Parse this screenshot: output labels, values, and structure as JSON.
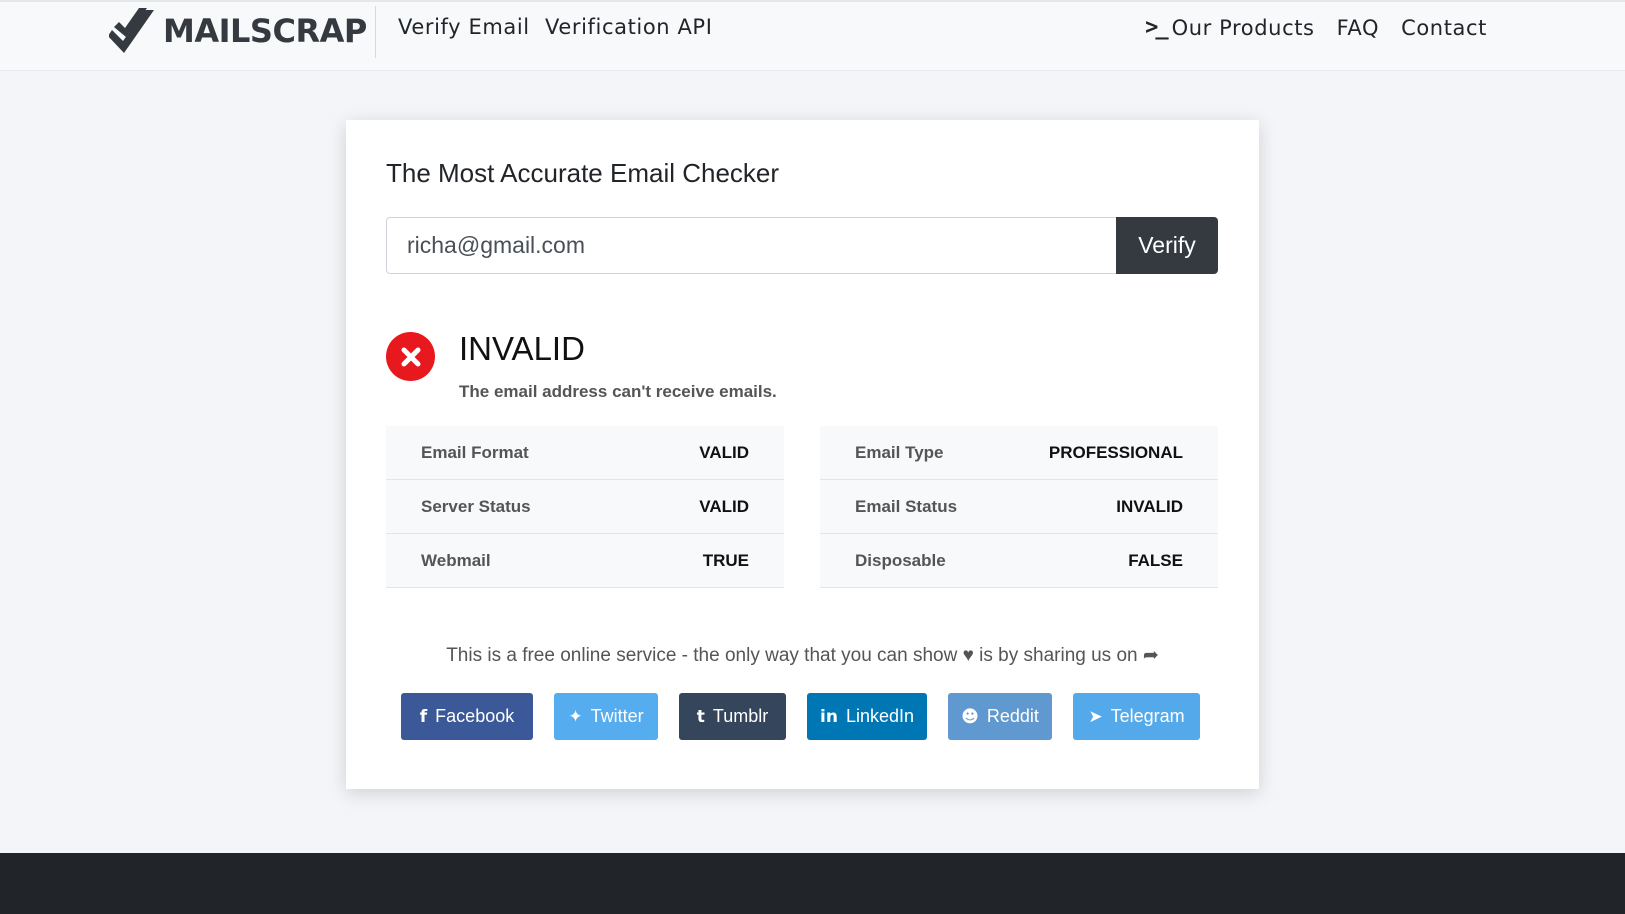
{
  "brand": {
    "name": "MAILSCRAP",
    "icon": "check-logo-icon"
  },
  "nav": {
    "left": [
      "Verify Email",
      "Verification API"
    ],
    "products": {
      "label": "Our Products",
      "icon": "terminal-icon"
    },
    "faq": "FAQ",
    "contact": "Contact"
  },
  "checker": {
    "title": "The Most Accurate Email Checker",
    "email_value": "richa@gmail.com",
    "verify_label": "Verify"
  },
  "result": {
    "status": "INVALID",
    "message": "The email address can't receive emails.",
    "status_color": "#e8181f",
    "left": [
      {
        "key": "Email Format",
        "value": "VALID"
      },
      {
        "key": "Server Status",
        "value": "VALID"
      },
      {
        "key": "Webmail",
        "value": "TRUE"
      }
    ],
    "right": [
      {
        "key": "Email Type",
        "value": "PROFESSIONAL"
      },
      {
        "key": "Email Status",
        "value": "INVALID"
      },
      {
        "key": "Disposable",
        "value": "FALSE"
      }
    ]
  },
  "share": {
    "text_before": "This is a free online service - the only way that you can show",
    "text_after": "is by sharing us on",
    "buttons": [
      {
        "label": "Facebook",
        "icon": "facebook-icon",
        "color": "#3b5998"
      },
      {
        "label": "Twitter",
        "icon": "twitter-icon",
        "color": "#55acee"
      },
      {
        "label": "Tumblr",
        "icon": "tumblr-icon",
        "color": "#35465c"
      },
      {
        "label": "LinkedIn",
        "icon": "linkedin-icon",
        "color": "#0077b5"
      },
      {
        "label": "Reddit",
        "icon": "reddit-icon",
        "color": "#5f99cf"
      },
      {
        "label": "Telegram",
        "icon": "telegram-icon",
        "color": "#54a9eb"
      }
    ]
  }
}
